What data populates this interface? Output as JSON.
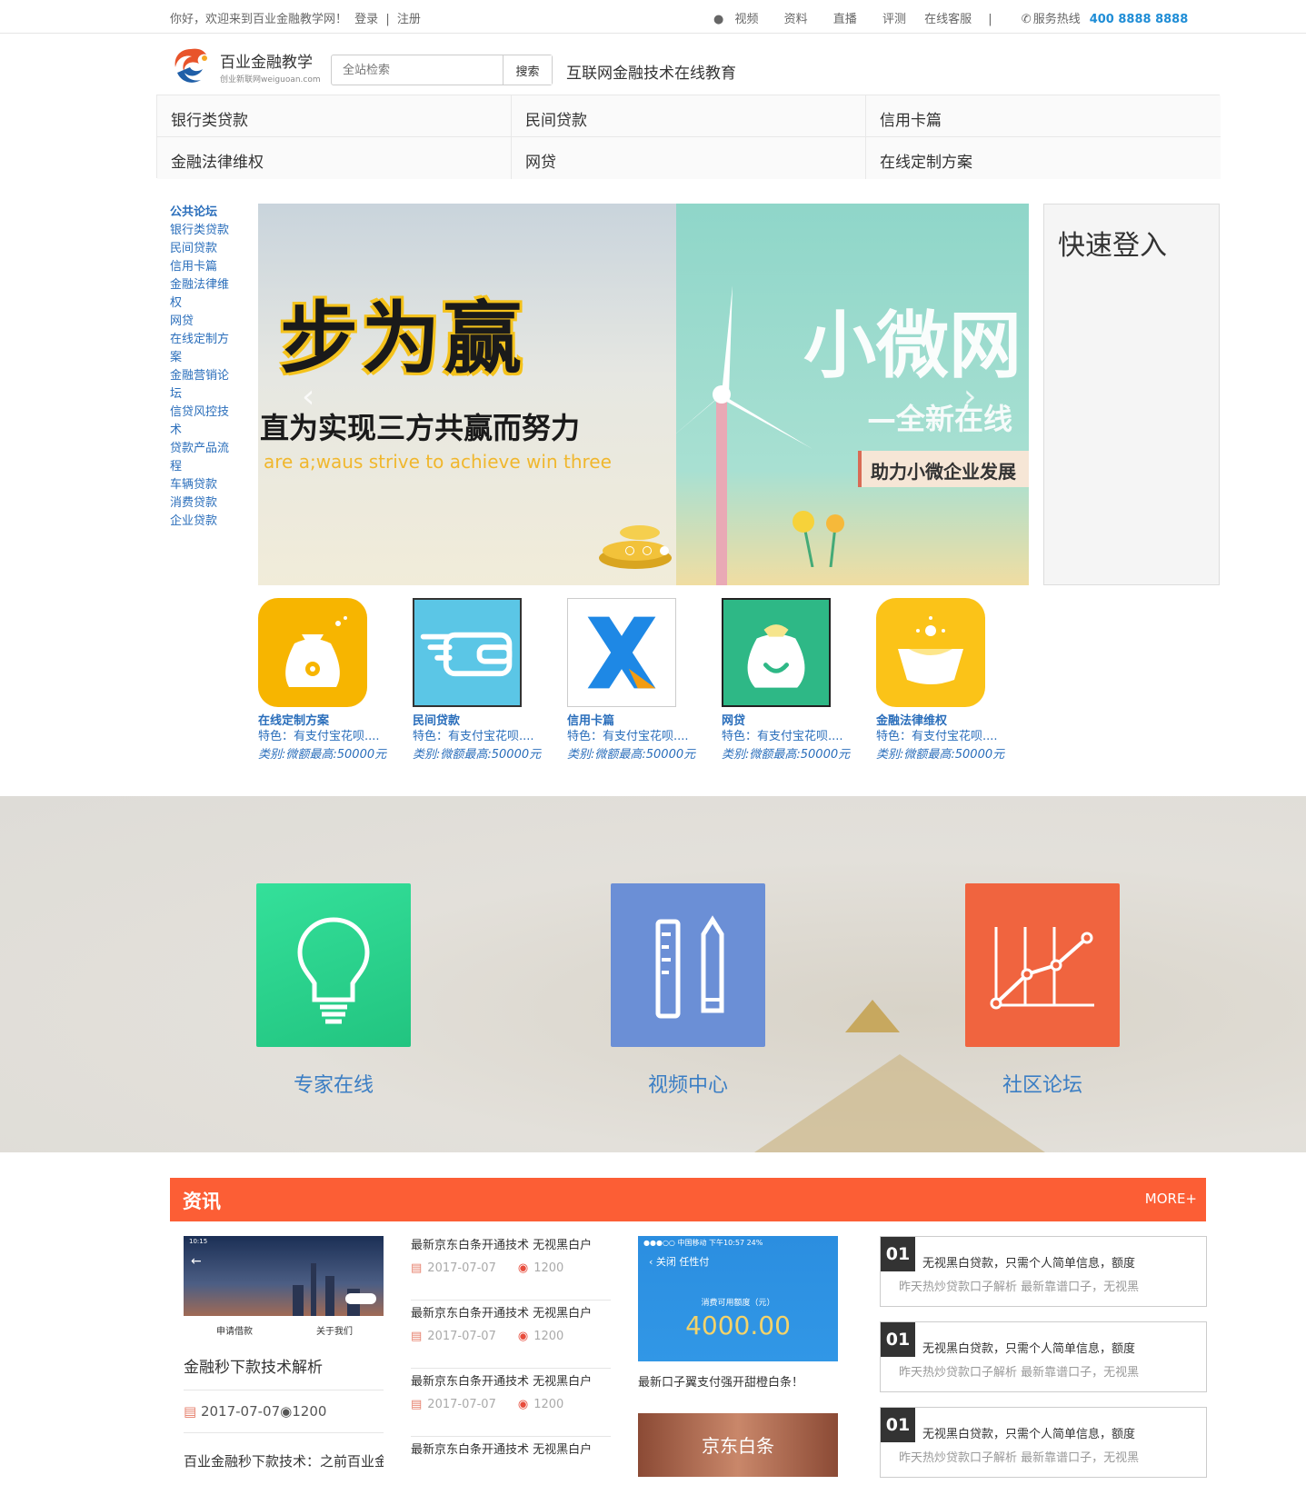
{
  "topbar": {
    "welcome": "你好，欢迎来到百业金融教学网！",
    "login": "登录",
    "sep": "|",
    "register": "注册",
    "links": [
      "视频",
      "资料",
      "直播",
      "评测",
      "在线客服"
    ],
    "divider": "|",
    "hotline_label": "服务热线",
    "hotline_number": "400 8888 8888"
  },
  "header": {
    "logo_name": "百业金融教学",
    "logo_sub": "创业新联网weiguoan.com",
    "search_placeholder": "全站检索",
    "search_button": "搜索",
    "slogan": "互联网金融技术在线教育"
  },
  "categories": [
    "银行类贷款",
    "民间贷款",
    "信用卡篇",
    "金融法律维权",
    "网贷",
    "在线定制方案"
  ],
  "sidebar": [
    {
      "label": "公共论坛",
      "head": true
    },
    {
      "label": "银行类贷款"
    },
    {
      "label": "民间贷款"
    },
    {
      "label": "信用卡篇"
    },
    {
      "label": "金融法律维权"
    },
    {
      "label": "网贷"
    },
    {
      "label": "在线定制方案"
    },
    {
      "label": "金融营销论坛"
    },
    {
      "label": "信贷风控技术"
    },
    {
      "label": "贷款产品流程"
    },
    {
      "label": "车辆贷款"
    },
    {
      "label": "消费贷款"
    },
    {
      "label": "企业贷款"
    }
  ],
  "banner": {
    "slide1_big": "步为赢",
    "slide1_sub": "直为实现三方共赢而努力",
    "slide1_eng": "are a;waus strive to achieve win three",
    "slide2_big": "小微网",
    "slide2_sub": "—全新在线",
    "slide2_tag": "助力小微企业发展",
    "prev": "‹",
    "next": "›",
    "dots": 3,
    "active_dot": 3
  },
  "login_panel": {
    "title": "快速登入"
  },
  "products": [
    {
      "title": "在线定制方案",
      "desc": "特色：有支付宝花呗....",
      "meta": "类别:微额最高:50000元",
      "color": "#f7b500",
      "icon": "money-bag-icon"
    },
    {
      "title": "民间贷款",
      "desc": "特色：有支付宝花呗....",
      "meta": "类别:微额最高:50000元",
      "color": "#5bc6e6",
      "icon": "winged-wallet-icon"
    },
    {
      "title": "信用卡篇",
      "desc": "特色：有支付宝花呗....",
      "meta": "类别:微额最高:50000元",
      "color": "#ffffff",
      "icon": "x-logo-icon"
    },
    {
      "title": "网贷",
      "desc": "特色：有支付宝花呗....",
      "meta": "类别:微额最高:50000元",
      "color": "#2eb886",
      "icon": "smile-bag-icon"
    },
    {
      "title": "金融法律维权",
      "desc": "特色：有支付宝花呗....",
      "meta": "类别:微额最高:50000元",
      "color": "#fbc318",
      "icon": "gold-ingot-icon"
    }
  ],
  "features": [
    {
      "label": "专家在线",
      "color": "#2dd48e",
      "icon": "lightbulb-icon"
    },
    {
      "label": "视频中心",
      "color": "#6b8fd6",
      "icon": "ruler-pencil-icon"
    },
    {
      "label": "社区论坛",
      "color": "#f0643f",
      "icon": "line-chart-icon"
    }
  ],
  "news": {
    "title": "资讯",
    "more": "MORE+",
    "feature": {
      "phone_tabs": [
        "申请借款",
        "关于我们"
      ],
      "title": "金融秒下款技术解析",
      "date": "2017-07-07",
      "views": "1200",
      "title2": "百业金融秒下款技术：之前百业金"
    },
    "list": [
      {
        "title": "最新京东白条开通技术 无视黑白户",
        "date": "2017-07-07",
        "views": "1200"
      },
      {
        "title": "最新京东白条开通技术 无视黑白户",
        "date": "2017-07-07",
        "views": "1200"
      },
      {
        "title": "最新京东白条开通技术 无视黑白户",
        "date": "2017-07-07",
        "views": "1200"
      },
      {
        "title": "最新京东白条开通技术 无视黑白户",
        "date": "",
        "views": ""
      }
    ],
    "phone2": {
      "statusbar": "●●●○○ 中国移动  下午10:57   24%",
      "nav": "‹  关闭      任性付",
      "label": "消费可用额度（元）",
      "amount": "4000.00",
      "caption": "最新口子翼支付强开甜橙白条！"
    },
    "phone3_text": "京东白条",
    "boxes": [
      {
        "num": "01",
        "l1": "无视黑白贷款，只需个人简单信息，额度",
        "l2": "昨天热炒贷款口子解析 最新靠谱口子，无视黑"
      },
      {
        "num": "01",
        "l1": "无视黑白贷款，只需个人简单信息，额度",
        "l2": "昨天热炒贷款口子解析 最新靠谱口子，无视黑"
      },
      {
        "num": "01",
        "l1": "无视黑白贷款，只需个人简单信息，额度",
        "l2": "昨天热炒贷款口子解析 最新靠谱口子，无视黑"
      }
    ]
  }
}
